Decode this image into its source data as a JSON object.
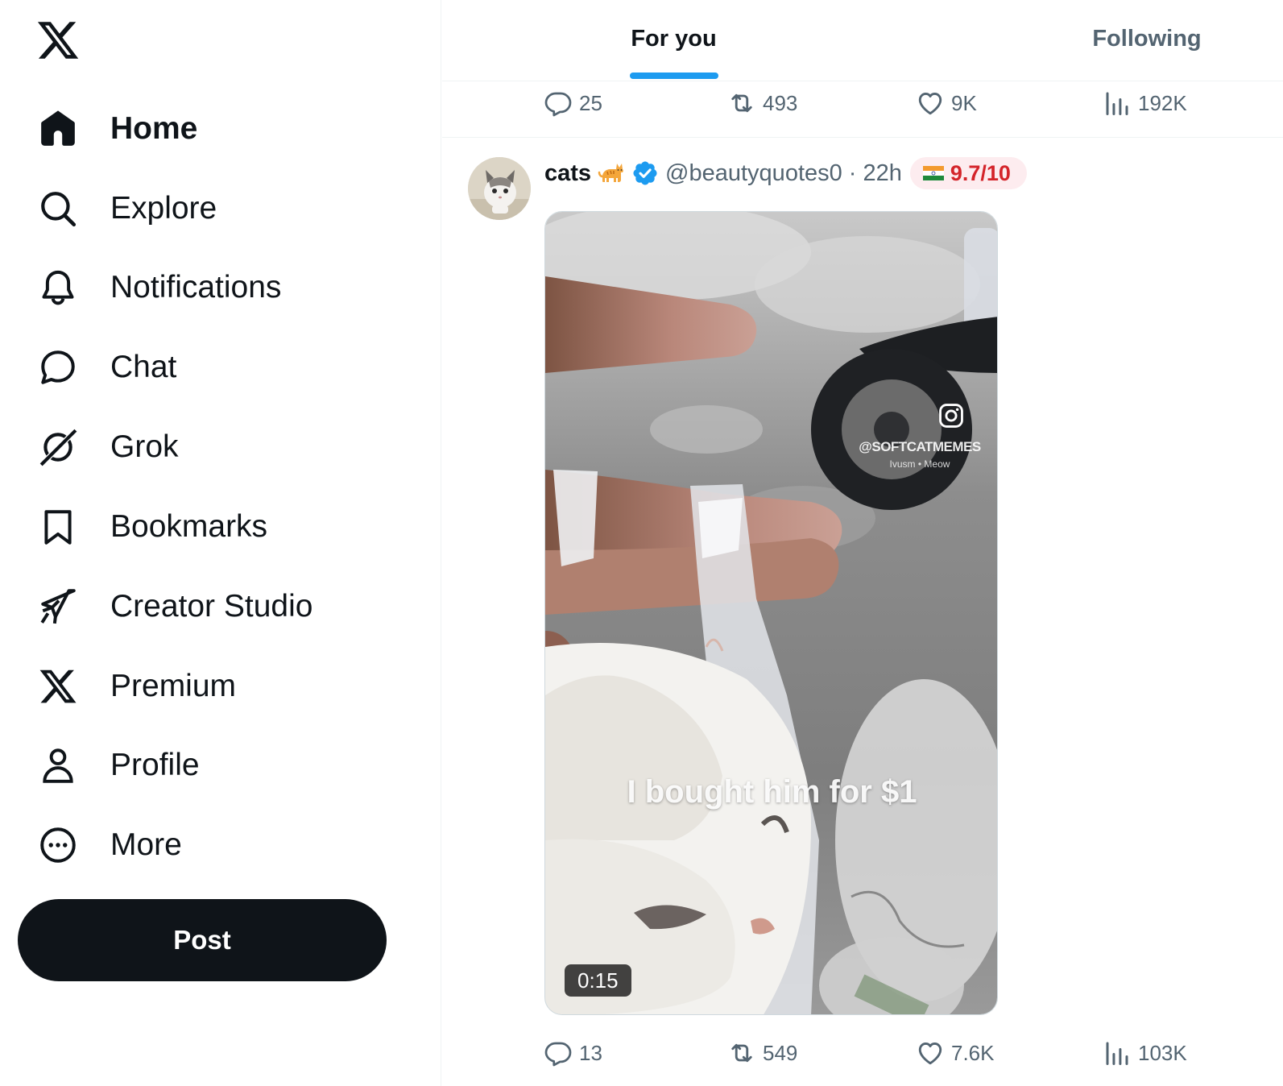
{
  "sidebar": {
    "logo_icon": "x-logo-icon",
    "items": [
      {
        "label": "Home",
        "icon": "home-icon",
        "active": true
      },
      {
        "label": "Explore",
        "icon": "search-icon"
      },
      {
        "label": "Notifications",
        "icon": "bell-icon"
      },
      {
        "label": "Chat",
        "icon": "chat-bubble-icon"
      },
      {
        "label": "Grok",
        "icon": "grok-icon"
      },
      {
        "label": "Bookmarks",
        "icon": "bookmark-icon"
      },
      {
        "label": "Creator Studio",
        "icon": "rocket-icon"
      },
      {
        "label": "Premium",
        "icon": "x-logo-icon"
      },
      {
        "label": "Profile",
        "icon": "person-icon"
      },
      {
        "label": "More",
        "icon": "more-circle-icon"
      }
    ],
    "post_button": "Post"
  },
  "tabs": {
    "items": [
      {
        "label": "For you",
        "active": true
      },
      {
        "label": "Following",
        "active": false
      }
    ],
    "accent_color": "#1d9bf0"
  },
  "previous_post": {
    "replies": "25",
    "reposts": "493",
    "likes": "9K",
    "views": "192K"
  },
  "post": {
    "display_name": "cats",
    "name_emoji_icon": "cat-emoji-icon",
    "verified_icon": "verified-badge-icon",
    "handle": "@beautyquotes0",
    "separator": "·",
    "time": "22h",
    "flag_icon": "india-flag-icon",
    "rating": "9.7/10",
    "media": {
      "watermark_handle": "@SOFTCATMEMES",
      "watermark_sub": "Ivusm • Meow",
      "caption": "I bought him for $1",
      "duration": "0:15"
    },
    "replies": "13",
    "reposts": "549",
    "likes": "7.6K",
    "views": "103K"
  },
  "colors": {
    "text_primary": "#0f1419",
    "text_secondary": "#536471",
    "rating_red": "#d4242a",
    "rating_bg": "#fdecef"
  }
}
